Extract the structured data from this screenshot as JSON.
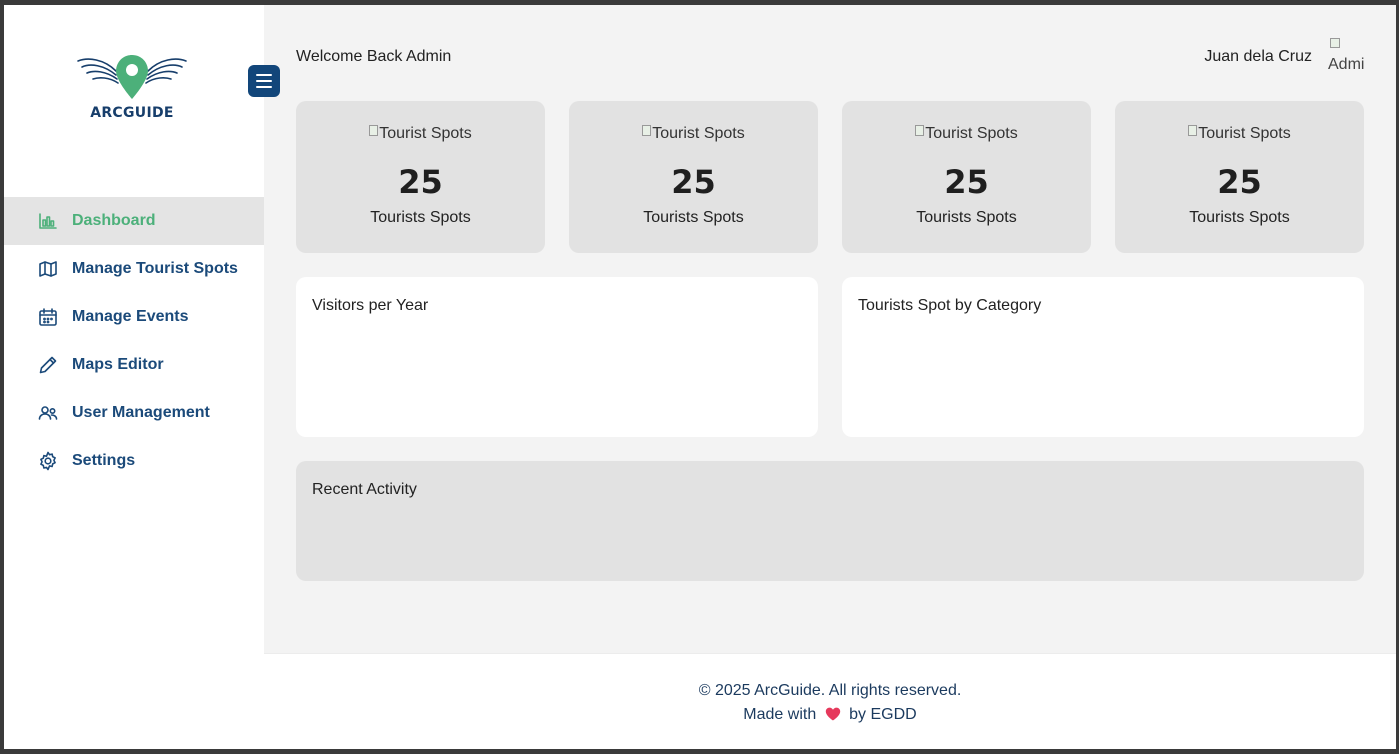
{
  "brand": {
    "logo_text": "ARCGUIDE",
    "primary_color": "#12467a",
    "accent_color": "#4cb07a"
  },
  "sidebar": {
    "items": [
      {
        "label": "Dashboard",
        "icon": "bar-chart-icon",
        "active": true
      },
      {
        "label": "Manage Tourist Spots",
        "icon": "map-icon",
        "active": false
      },
      {
        "label": "Manage Events",
        "icon": "calendar-icon",
        "active": false
      },
      {
        "label": "Maps Editor",
        "icon": "pencil-icon",
        "active": false
      },
      {
        "label": "User Management",
        "icon": "users-icon",
        "active": false
      },
      {
        "label": "Settings",
        "icon": "gear-icon",
        "active": false
      }
    ]
  },
  "header": {
    "welcome": "Welcome Back Admin",
    "user_name": "Juan dela Cruz",
    "avatar_alt": "Admi"
  },
  "stats": [
    {
      "img_alt": "Tourist Spots",
      "value": "25",
      "label": "Tourists Spots"
    },
    {
      "img_alt": "Tourist Spots",
      "value": "25",
      "label": "Tourists Spots"
    },
    {
      "img_alt": "Tourist Spots",
      "value": "25",
      "label": "Tourists Spots"
    },
    {
      "img_alt": "Tourist Spots",
      "value": "25",
      "label": "Tourists Spots"
    }
  ],
  "panels": {
    "visitors_title": "Visitors per Year",
    "category_title": "Tourists Spot by Category",
    "activity_title": "Recent Activity"
  },
  "footer": {
    "copyright": "© 2025 ArcGuide. All rights reserved.",
    "made_prefix": "Made with",
    "made_suffix": "by EGDD",
    "heart_color": "#e6395c"
  }
}
